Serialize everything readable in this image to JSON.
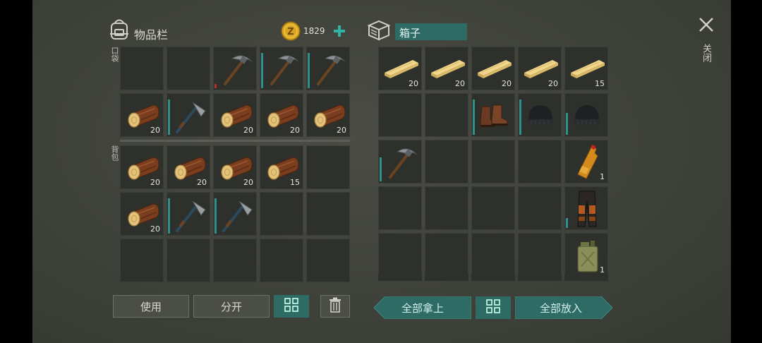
{
  "inventory": {
    "title": "物品栏",
    "coins": "1829",
    "pocket_label": "口袋",
    "backpack_label": "背包",
    "pocket_slots": [
      {
        "item": "",
        "qty": ""
      },
      {
        "item": "",
        "qty": ""
      },
      {
        "item": "pickaxe-icon",
        "qty": "",
        "durability": 0.1,
        "dur_color": "#b0302a"
      },
      {
        "item": "pickaxe-icon",
        "qty": "",
        "durability": 0.9
      },
      {
        "item": "pickaxe-icon",
        "qty": "",
        "durability": 0.9
      },
      {
        "item": "log-icon",
        "qty": "20"
      },
      {
        "item": "hatchet-icon",
        "qty": "",
        "durability": 0.9
      },
      {
        "item": "log-icon",
        "qty": "20"
      },
      {
        "item": "log-icon",
        "qty": "20"
      },
      {
        "item": "log-icon",
        "qty": "20"
      }
    ],
    "backpack_slots": [
      {
        "item": "log-icon",
        "qty": "20"
      },
      {
        "item": "log-icon",
        "qty": "20"
      },
      {
        "item": "log-icon",
        "qty": "20"
      },
      {
        "item": "log-icon",
        "qty": "15"
      },
      {
        "item": "",
        "qty": ""
      },
      {
        "item": "log-icon",
        "qty": "20"
      },
      {
        "item": "hatchet-icon",
        "qty": "",
        "durability": 0.9
      },
      {
        "item": "hatchet-icon",
        "qty": "",
        "durability": 0.9
      },
      {
        "item": "",
        "qty": ""
      },
      {
        "item": "",
        "qty": ""
      },
      {
        "item": "",
        "qty": ""
      },
      {
        "item": "",
        "qty": ""
      },
      {
        "item": "",
        "qty": ""
      },
      {
        "item": "",
        "qty": ""
      },
      {
        "item": "",
        "qty": ""
      }
    ],
    "use_button": "使用",
    "split_button": "分开"
  },
  "chest": {
    "title": "箱子",
    "slots": [
      {
        "item": "plank-icon",
        "qty": "20"
      },
      {
        "item": "plank-icon",
        "qty": "20"
      },
      {
        "item": "plank-icon",
        "qty": "20"
      },
      {
        "item": "plank-icon",
        "qty": "20"
      },
      {
        "item": "plank-icon",
        "qty": "15"
      },
      {
        "item": "",
        "qty": ""
      },
      {
        "item": "",
        "qty": ""
      },
      {
        "item": "boots-icon",
        "qty": "",
        "durability": 0.9
      },
      {
        "item": "beanie-icon",
        "qty": "",
        "durability": 0.9
      },
      {
        "item": "beanie-icon",
        "qty": "",
        "durability": 0.55
      },
      {
        "item": "pickaxe-icon",
        "qty": "",
        "durability": 0.6
      },
      {
        "item": "",
        "qty": ""
      },
      {
        "item": "",
        "qty": ""
      },
      {
        "item": "",
        "qty": ""
      },
      {
        "item": "bottle-icon",
        "qty": "1"
      },
      {
        "item": "",
        "qty": ""
      },
      {
        "item": "",
        "qty": ""
      },
      {
        "item": "",
        "qty": ""
      },
      {
        "item": "",
        "qty": ""
      },
      {
        "item": "pants-icon",
        "qty": "",
        "durability": 0.25
      },
      {
        "item": "",
        "qty": ""
      },
      {
        "item": "",
        "qty": ""
      },
      {
        "item": "",
        "qty": ""
      },
      {
        "item": "",
        "qty": ""
      },
      {
        "item": "jerrycan-icon",
        "qty": "1"
      }
    ],
    "take_all_button": "全部拿上",
    "put_all_button": "全部放入"
  },
  "close_label": "关闭",
  "colors": {
    "accent": "#2d6b64",
    "durability": "#2f8f8a",
    "slot": "#2e302c"
  }
}
